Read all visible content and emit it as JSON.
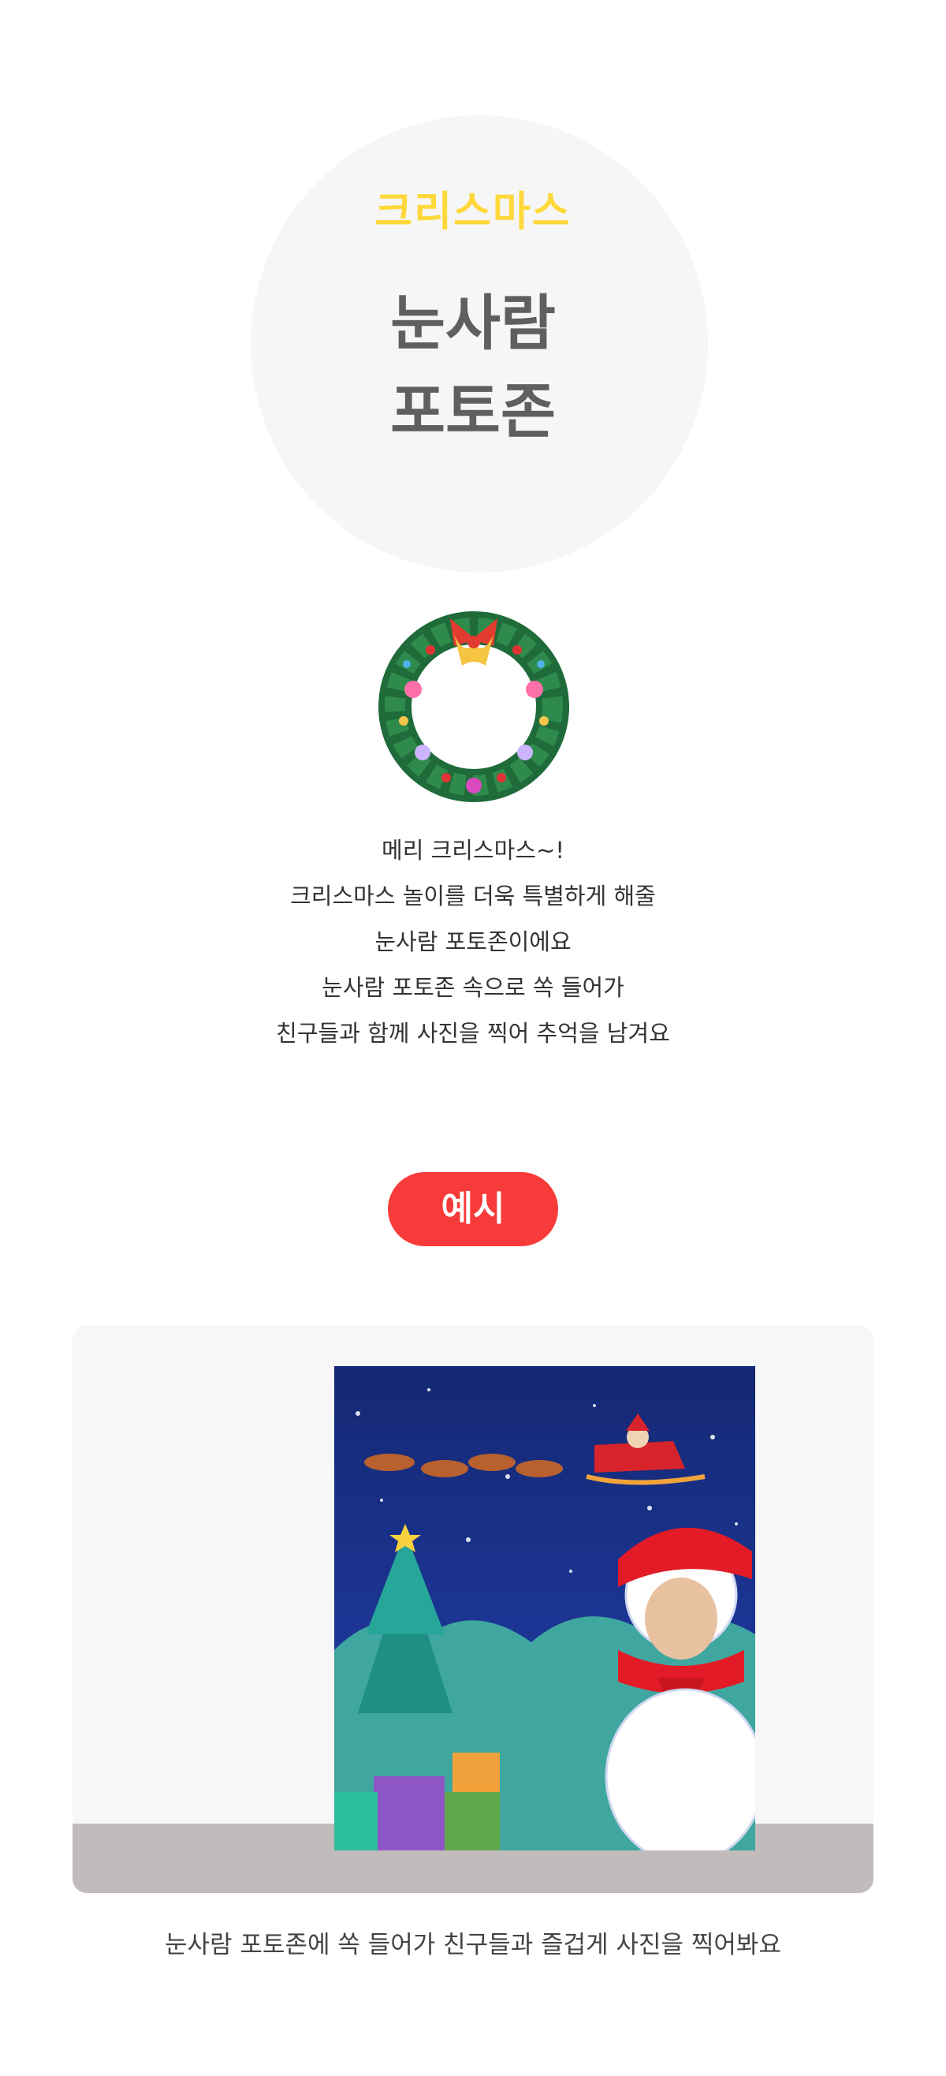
{
  "hero": {
    "subtitle": "크리스마스",
    "title_line1": "눈사람",
    "title_line2": "포토존"
  },
  "description": {
    "lines": [
      "메리 크리스마스~!",
      "크리스마스 놀이를 더욱 특별하게 해줄",
      "눈사람 포토존이에요",
      "눈사람 포토존 속으로 쏙 들어가",
      "친구들과 함께 사진을 찍어 추억을 남겨요"
    ]
  },
  "badge": {
    "label": "예시"
  },
  "example": {
    "caption": "눈사람 포토존에 쏙 들어가 친구들과 즐겁게 사진을 찍어봐요"
  },
  "colors": {
    "subtitle": "#ffd83a",
    "title": "#5f5f5f",
    "badge": "#f73a3a",
    "night_sky": "#1b2f8f"
  }
}
